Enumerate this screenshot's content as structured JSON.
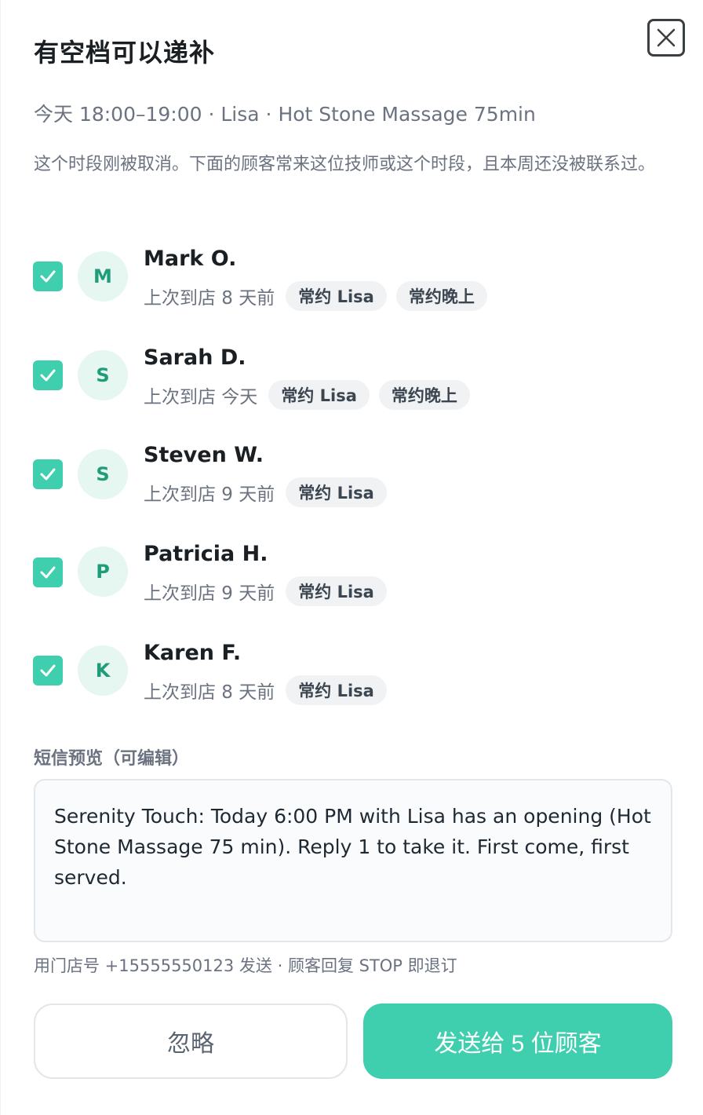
{
  "dialog": {
    "title": "有空档可以递补",
    "close_label": "×",
    "subtitle": "今天 18:00–19:00 · Lisa · Hot Stone Massage 75min",
    "description": "这个时段刚被取消。下面的顾客常来这位技师或这个时段，且本周还没被联系过。"
  },
  "customers": [
    {
      "initial": "M",
      "name": "Mark O.",
      "checked": true,
      "last_visit": "上次到店 8 天前",
      "tags": [
        "常约 Lisa",
        "常约晚上"
      ]
    },
    {
      "initial": "S",
      "name": "Sarah D.",
      "checked": true,
      "last_visit": "上次到店 今天",
      "tags": [
        "常约 Lisa",
        "常约晚上"
      ]
    },
    {
      "initial": "S",
      "name": "Steven W.",
      "checked": true,
      "last_visit": "上次到店 9 天前",
      "tags": [
        "常约 Lisa"
      ]
    },
    {
      "initial": "P",
      "name": "Patricia H.",
      "checked": true,
      "last_visit": "上次到店 9 天前",
      "tags": [
        "常约 Lisa"
      ]
    },
    {
      "initial": "K",
      "name": "Karen F.",
      "checked": true,
      "last_visit": "上次到店 8 天前",
      "tags": [
        "常约 Lisa"
      ]
    }
  ],
  "sms": {
    "label": "短信预览（可编辑）",
    "message": "Serenity Touch: Today 6:00 PM with Lisa has an opening (Hot Stone Massage 75 min). Reply 1 to take it. First come, first served.",
    "note": "用门店号 +15555550123 发送 · 顾客回复 STOP 即退订"
  },
  "actions": {
    "ignore_label": "忽略",
    "send_label": "发送给 5 位顾客"
  },
  "colors": {
    "accent": "#3fcfae",
    "avatar_bg": "#e6f6f0",
    "avatar_text": "#1f9d79"
  },
  "icons": {
    "close": "close-icon",
    "check": "checkmark-icon"
  }
}
